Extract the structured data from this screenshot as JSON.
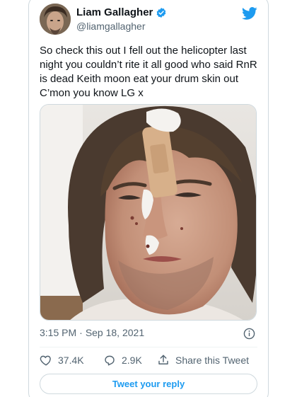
{
  "author": {
    "display_name": "Liam Gallagher",
    "handle": "@liamgallagher",
    "avatar_icon": "avatar-photo",
    "verified_icon": "verified-badge-icon"
  },
  "tweet": {
    "text": "So check this out I fell out the helicopter last night you couldn’t rite it all good who said RnR is dead Keith moon eat your drum skin out C’mon you know LG x",
    "media_icon": "selfie-photo-with-bandage"
  },
  "meta": {
    "time": "3:15 PM",
    "separator": "·",
    "date": "Sep 18, 2021"
  },
  "actions": {
    "like_count": "37.4K",
    "reply_count": "2.9K",
    "share_label": "Share this Tweet"
  },
  "reply_button": {
    "label": "Tweet your reply"
  },
  "colors": {
    "brand": "#1d9bf0",
    "text": "#0f1419",
    "secondary_text": "#536471",
    "border": "#cfd9de"
  }
}
